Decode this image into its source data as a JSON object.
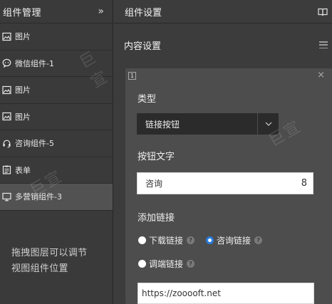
{
  "left": {
    "title": "组件管理",
    "collapse": "»",
    "layers": [
      {
        "icon": "image-icon",
        "label": "图片"
      },
      {
        "icon": "chat-icon",
        "label": "微信组件-1"
      },
      {
        "icon": "image-icon",
        "label": "图片"
      },
      {
        "icon": "image-icon",
        "label": "图片"
      },
      {
        "icon": "headset-icon",
        "label": "咨询组件-5"
      },
      {
        "icon": "form-icon",
        "label": "表单"
      },
      {
        "icon": "monitor-icon",
        "label": "多营销组件-3"
      }
    ],
    "active_index": 6,
    "hint": "拖拽图层可以调节视图组件位置"
  },
  "right": {
    "title": "组件设置",
    "section_title": "内容设置",
    "card": {
      "badge": "1",
      "close": "×",
      "type_label": "类型",
      "type_value": "链接按钮",
      "button_text_label": "按钮文字",
      "button_text_value": "咨询",
      "button_text_count": "8",
      "add_link_label": "添加链接",
      "radio_download": "下载链接",
      "radio_consult": "咨询链接",
      "radio_app": "调端链接",
      "selected_radio": "radio_consult",
      "help_mark": "?",
      "url_value": "https://zooooft.net"
    }
  },
  "watermark": {
    "text": "巨宣"
  },
  "colors": {
    "accent": "#2a7ddc",
    "active_row": "#525252"
  }
}
